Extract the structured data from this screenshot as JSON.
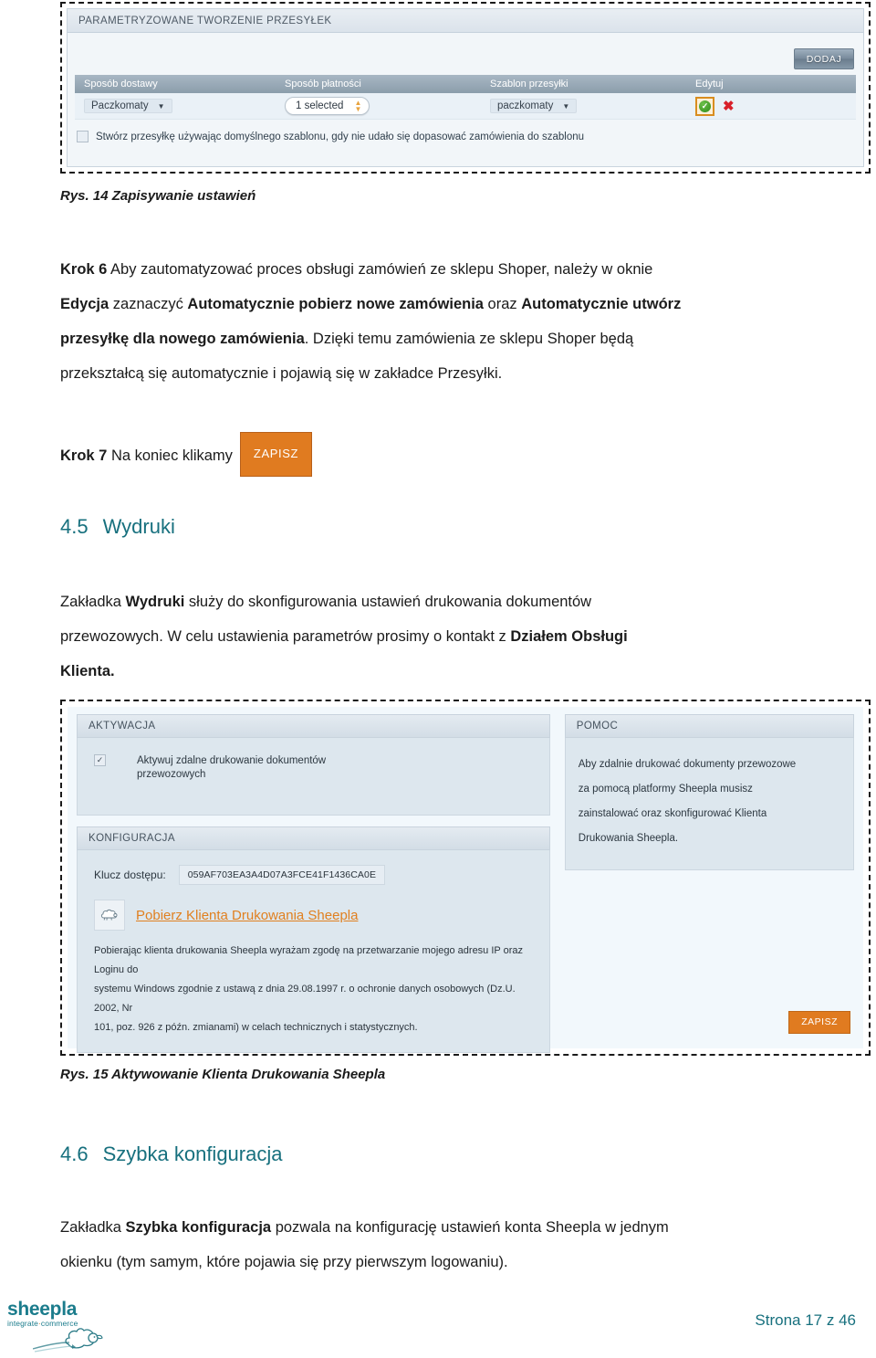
{
  "figure14": {
    "panel_title": "PARAMETRYZOWANE TWORZENIE PRZESYŁEK",
    "add_button": "DODAJ",
    "table": {
      "headers": [
        "Sposób dostawy",
        "Sposób płatności",
        "Szablon przesyłki",
        "Edytuj"
      ],
      "rows": [
        {
          "delivery_method": "Paczkomaty",
          "payment_method": "1 selected",
          "shipment_template": "paczkomaty",
          "accept_icon": "check-circle-icon",
          "delete_icon": "x-mark-icon"
        }
      ]
    },
    "default_template_checkbox": {
      "label": "Stwórz przesyłkę używając domyślnego szablonu, gdy nie udało się dopasować zamówienia do szablonu",
      "checked": false
    }
  },
  "caption14": "Rys. 14 Zapisywanie ustawień",
  "step6": {
    "label": "Krok 6",
    "line1_rest": " Aby zautomatyzować proces obsługi zamówień ze sklepu Shoper, należy w oknie",
    "line2_a": "Edycja",
    "line2_b": " zaznaczyć ",
    "line2_c": "Automatycznie pobierz nowe zamówienia",
    "line2_d": " oraz ",
    "line2_e": "Automatycznie utwórz",
    "line3_a": "przesyłkę dla nowego zamówienia",
    "line3_b": ". Dzięki temu zamówienia ze sklepu Shoper będą",
    "line4": "przekształcą się automatycznie i pojawią się w zakładce Przesyłki."
  },
  "step7": {
    "label": "Krok 7",
    "text": " Na koniec klikamy",
    "button": "ZAPISZ"
  },
  "section45": {
    "number": "4.5",
    "title": "Wydruki",
    "body_line1_a": "Zakładka ",
    "body_line1_b": "Wydruki",
    "body_line1_c": " służy do skonfigurowania ustawień drukowania dokumentów",
    "body_line2_a": "przewozowych. W celu ustawienia parametrów prosimy o kontakt z ",
    "body_line2_b": "Działem Obsługi",
    "body_line3": "Klienta."
  },
  "figure15": {
    "activation": {
      "header": "AKTYWACJA",
      "checkbox_label_line1": "Aktywuj zdalne drukowanie dokumentów",
      "checkbox_label_line2": "przewozowych",
      "checked": true
    },
    "configuration": {
      "header": "KONFIGURACJA",
      "key_label": "Klucz dostępu:",
      "key_value": "059AF703EA3A4D07A3FCE41F1436CA0E",
      "download_icon": "sheep-cloud-icon",
      "download_link": "Pobierz Klienta Drukowania Sheepla",
      "legal_line1": "Pobierając klienta drukowania Sheepla wyrażam zgodę na przetwarzanie mojego adresu IP oraz Loginu do",
      "legal_line2": "systemu Windows zgodnie z ustawą z dnia 29.08.1997 r. o ochronie danych osobowych (Dz.U. 2002, Nr",
      "legal_line3": "101, poz. 926 z późn. zmianami) w celach technicznych i statystycznych."
    },
    "help": {
      "header": "POMOC",
      "line1": "Aby zdalnie drukować dokumenty przewozowe",
      "line2": "za pomocą platformy Sheepla musisz",
      "line3": "zainstalować oraz skonfigurować Klienta",
      "line4": "Drukowania Sheepla."
    },
    "save_button": "ZAPISZ"
  },
  "caption15": "Rys. 15 Aktywowanie Klienta Drukowania Sheepla",
  "section46": {
    "number": "4.6",
    "title": "Szybka konfiguracja",
    "body_line1_a": "Zakładka ",
    "body_line1_b": "Szybka konfiguracja",
    "body_line1_c": " pozwala na konfigurację ustawień konta Sheepla w jednym",
    "body_line2": "okienku (tym samym, które pojawia się przy pierwszym logowaniu)."
  },
  "footer": {
    "logo_word": "sheepla",
    "logo_tagline_a": "integrate",
    "logo_tagline_mid": "·",
    "logo_tagline_b": "commerce",
    "page_number": "Strona 17 z 46"
  },
  "colors": {
    "accent_orange": "#e07b20",
    "heading_teal": "#17707e",
    "panel_blue": "#dde7ee",
    "ok_green": "#2e8b18",
    "delete_red": "#d8202a"
  }
}
